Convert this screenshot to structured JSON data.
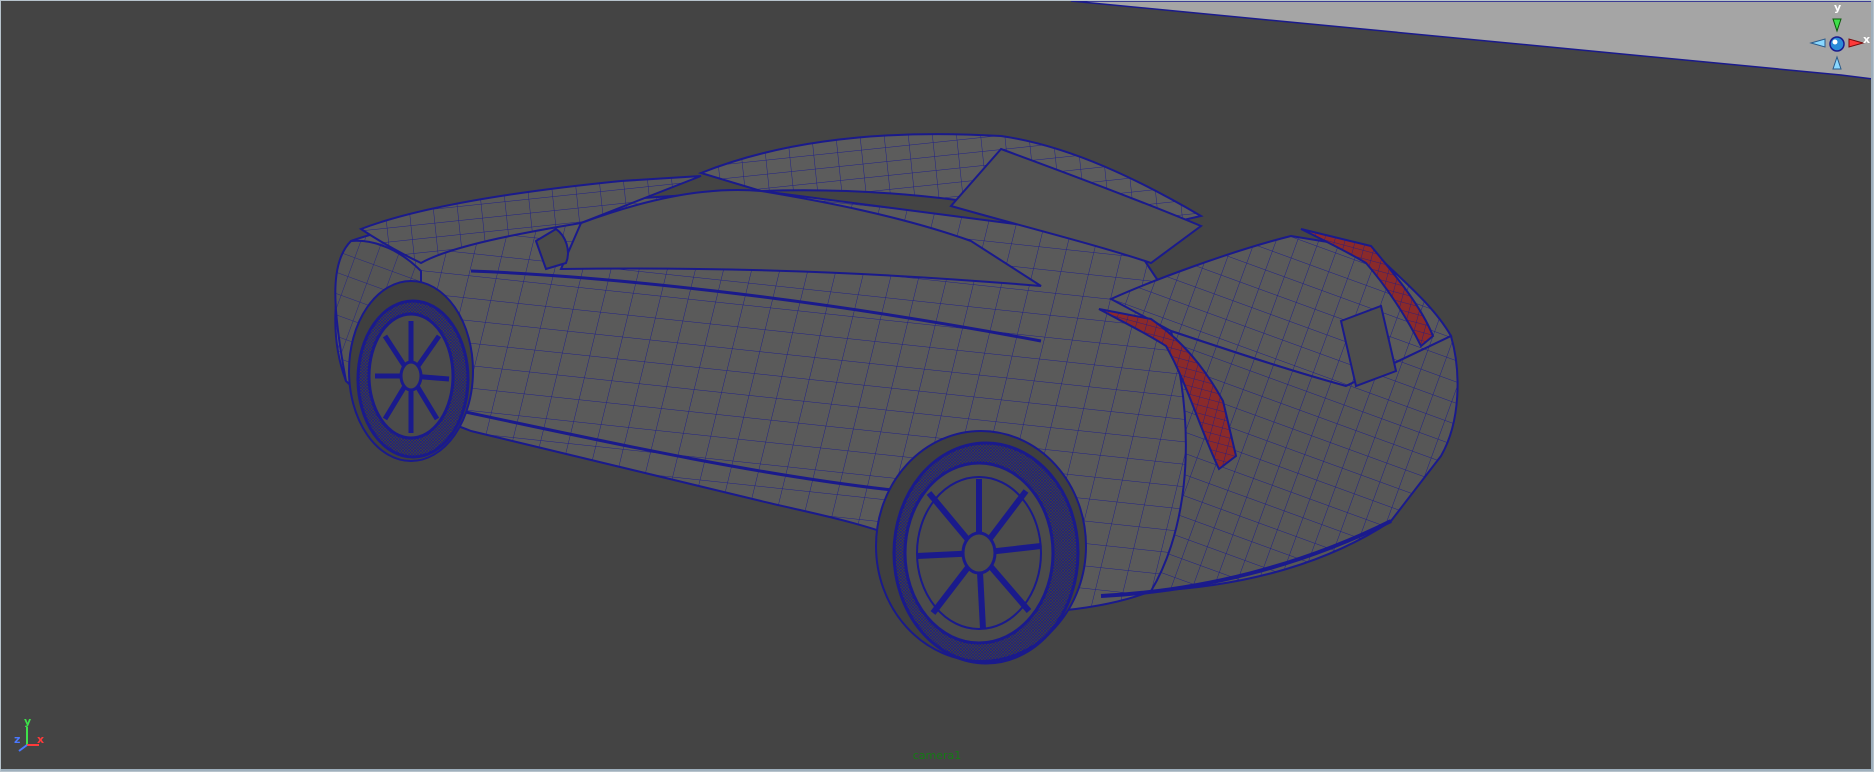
{
  "viewport": {
    "camera_name": "camera1",
    "background_color": "#444444",
    "wireframe_color": "#1a1a8c",
    "shaded_color": "#5a5a5a",
    "taillight_color": "#8a2a2a",
    "ground_plane_color": "#a5a5a5"
  },
  "view_cube": {
    "y_label": "y",
    "x_label": "x",
    "icon": "view-cube-icon"
  },
  "axis_indicator": {
    "y_label": "y",
    "x_label": "x",
    "z_label": "z"
  },
  "model": {
    "icon": "car-mesh-icon"
  }
}
